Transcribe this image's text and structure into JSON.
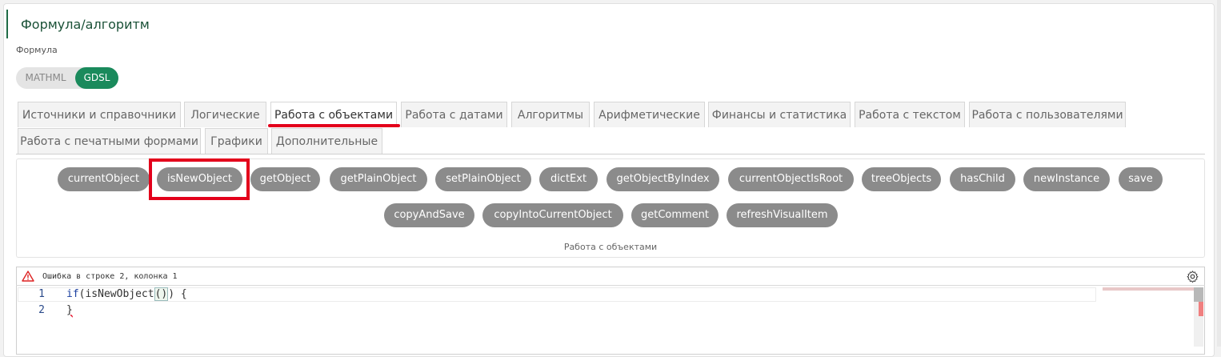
{
  "section": {
    "title": "Формула/алгоритм",
    "field_label": "Формула"
  },
  "toggle": {
    "options": [
      "MATHML",
      "GDSL"
    ],
    "selected": "GDSL"
  },
  "tabs": {
    "row1": [
      "Источники и справочники",
      "Логические",
      "Работа с объектами",
      "Работа с датами",
      "Алгоритмы",
      "Арифметические",
      "Финансы и статистика",
      "Работа с текстом",
      "Работа с пользователями"
    ],
    "row2": [
      "Работа с печатными формами",
      "Графики",
      "Дополнительные"
    ],
    "active": "Работа с объектами"
  },
  "functions": {
    "row1": [
      "currentObject",
      "isNewObject",
      "getObject",
      "getPlainObject",
      "setPlainObject",
      "dictExt",
      "getObjectByIndex",
      "currentObjectIsRoot",
      "treeObjects",
      "hasChild",
      "newInstance",
      "save"
    ],
    "row2": [
      "copyAndSave",
      "copyIntoCurrentObject",
      "getComment",
      "refreshVisualItem"
    ],
    "caption": "Работа с объектами",
    "highlighted": "isNewObject"
  },
  "editor": {
    "error_text": "Ошибка в строке 2, колонка 1",
    "lines": [
      {
        "num": "1",
        "kw": "if",
        "rest_a": "(isNewObject",
        "paren": "()",
        "rest_b": ") {"
      },
      {
        "num": "2",
        "text": "}"
      }
    ]
  },
  "colors": {
    "accent": "#1a8a5c",
    "highlight": "#e3001b",
    "chip": "#8b8b8b"
  },
  "icons": {
    "error": "warning-triangle-icon",
    "settings": "gear-icon"
  }
}
